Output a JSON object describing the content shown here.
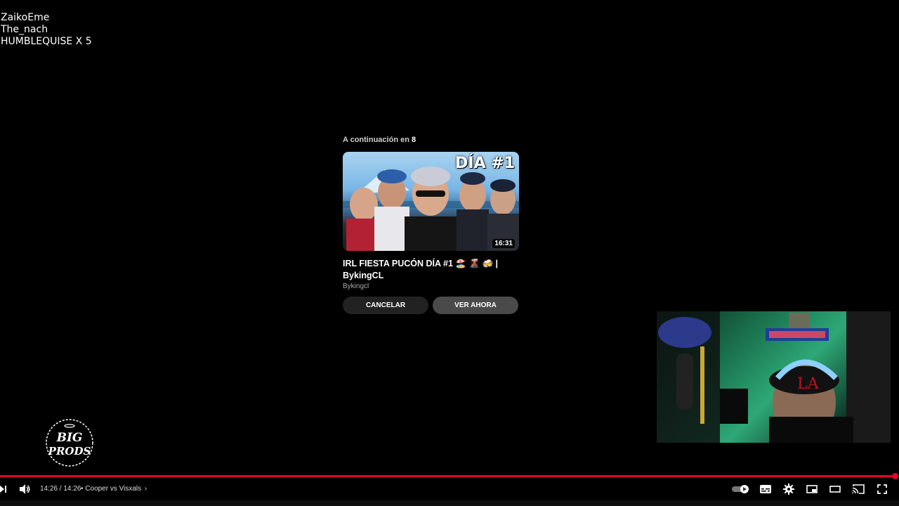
{
  "overlay": {
    "names": [
      "ZaikoEme",
      "The_nach",
      "HUMBLEQUISE X 5"
    ]
  },
  "up_next": {
    "label_prefix": "A continuación en",
    "countdown": "8",
    "thumbnail_badge": "DÍA #1",
    "duration": "16:31",
    "title": "IRL FIESTA PUCÓN DÍA #1 🏖️ 🌋 🍻 | BykingCL",
    "channel": "Bykingcl",
    "cancel_label": "CANCELAR",
    "watch_now_label": "VER AHORA"
  },
  "logo": {
    "line1": "BIG",
    "line2": "PRODS"
  },
  "player": {
    "time_current": "14:26",
    "time_total": "14:26",
    "time_display": "14:26 / 14:26",
    "chapter": "• Cooper vs Visxals",
    "progress": 1.0,
    "accent_color": "#e3002b",
    "icons": [
      "next-icon",
      "volume-icon",
      "chevron-right-icon",
      "autoplay-toggle-icon",
      "subtitles-icon",
      "settings-icon",
      "miniplayer-icon",
      "theater-icon",
      "cast-icon",
      "fullscreen-icon"
    ]
  }
}
